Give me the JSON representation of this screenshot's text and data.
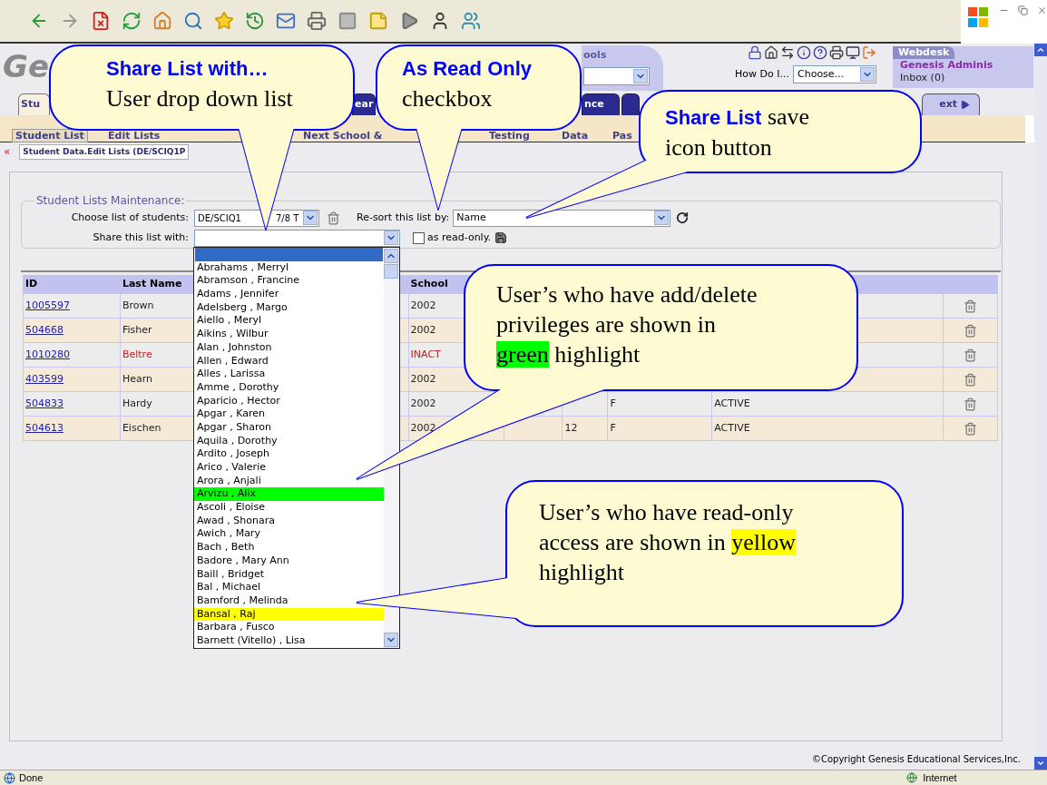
{
  "header": {
    "logo": "Ge",
    "schools_tab": "ools",
    "how_do_i": "How Do I...",
    "how_do_i_select": "Choose...",
    "webdesk": {
      "title": "Webdesk",
      "user": "Genesis Adminis",
      "inbox": "Inbox (0)"
    }
  },
  "tabs": [
    {
      "label": "Stu",
      "kind": "light"
    },
    {
      "label": "ear",
      "kind": "dark"
    },
    {
      "label": "nce",
      "kind": "dark"
    },
    {
      "kind": "dark"
    },
    {
      "label": "ext",
      "kind": "next"
    }
  ],
  "subtabs": [
    {
      "label": "Student List",
      "selected": true
    },
    {
      "label": "Edit Lists",
      "selected": false
    },
    {
      "label": "Next School &",
      "selected": false
    },
    {
      "label": "Testing",
      "selected": false
    },
    {
      "label": "Data",
      "selected": false
    },
    {
      "label": "Pas",
      "selected": false
    }
  ],
  "breadcrumb": {
    "back": "«",
    "path": "Student Data.Edit Lists (DE/SCIQ1P"
  },
  "maintenance": {
    "legend": "Student Lists Maintenance:",
    "choose_label": "Choose list of students:",
    "choose_value": [
      "DE/SCIQ1",
      "7/8 T"
    ],
    "resort_label": "Re-sort this list by:",
    "resort_value": "Name",
    "share_label": "Share this list with:",
    "read_only_label": "as read-only.",
    "read_only_checked": false
  },
  "share_options": [
    {
      "text": "Abrahams , Merryl"
    },
    {
      "text": "Abramson , Francine"
    },
    {
      "text": "Adams , Jennifer"
    },
    {
      "text": "Adelsberg , Margo"
    },
    {
      "text": "Aiello , Meryl"
    },
    {
      "text": "Aikins , Wilbur"
    },
    {
      "text": "Alan , Johnston"
    },
    {
      "text": "Allen , Edward"
    },
    {
      "text": "Alles , Larissa"
    },
    {
      "text": "Amme , Dorothy"
    },
    {
      "text": "Aparicio , Hector"
    },
    {
      "text": "Apgar , Karen"
    },
    {
      "text": "Apgar , Sharon"
    },
    {
      "text": "Aquila , Dorothy"
    },
    {
      "text": "Ardito , Joseph"
    },
    {
      "text": "Arico , Valerie"
    },
    {
      "text": "Arora , Anjali"
    },
    {
      "text": "Arvizu , Alix",
      "color": "#00ff00"
    },
    {
      "text": "Ascoli , Eloise"
    },
    {
      "text": "Awad , Shonara"
    },
    {
      "text": "Awich , Mary"
    },
    {
      "text": "Bach , Beth"
    },
    {
      "text": "Badore , Mary Ann"
    },
    {
      "text": "Baill , Bridget"
    },
    {
      "text": "Bal , Michael"
    },
    {
      "text": "Bamford , Melinda"
    },
    {
      "text": "Bansal , Raj",
      "color": "#ffff00"
    },
    {
      "text": "Barbara , Fusco"
    },
    {
      "text": "Barnett (Vitello) , Lisa"
    }
  ],
  "table": {
    "columns": [
      "ID",
      "Last Name",
      "School"
    ],
    "rows": [
      {
        "id": "1005597",
        "last_name": "Brown",
        "school": "2002",
        "inactive": false
      },
      {
        "id": "504668",
        "last_name": "Fisher",
        "school": "2002",
        "inactive": false
      },
      {
        "id": "1010280",
        "last_name": "Beltre",
        "school": "INACT",
        "inactive": true
      },
      {
        "id": "403599",
        "last_name": "Hearn",
        "school": "2002",
        "inactive": false
      },
      {
        "id": "504833",
        "last_name": "Hardy",
        "school": "2002",
        "inactive": false,
        "column_6": "F",
        "column_7": "ACTIVE"
      },
      {
        "id": "504613",
        "last_name": "Eischen",
        "school": "2002",
        "inactive": false,
        "column_5": "12",
        "column_6": "F",
        "column_7": "ACTIVE"
      }
    ]
  },
  "copyright": "©Copyright Genesis Educational Services,Inc.",
  "status_bar": {
    "left": "Done",
    "zone": "Internet"
  },
  "callouts": [
    {
      "lines": [
        [
          {
            "kind": "title",
            "text": "Share List with…"
          }
        ],
        [
          {
            "kind": "plain",
            "text": "User drop down list"
          }
        ]
      ]
    },
    {
      "lines": [
        [
          {
            "kind": "title",
            "text": "As Read Only"
          }
        ],
        [
          {
            "kind": "plain",
            "text": "checkbox"
          }
        ]
      ]
    },
    {
      "lines": [
        [
          {
            "kind": "title",
            "text": "Share List"
          },
          {
            "kind": "plain",
            "text": " save"
          }
        ],
        [
          {
            "kind": "plain",
            "text": "icon button"
          }
        ]
      ]
    },
    {
      "lines": [
        [
          {
            "kind": "plain",
            "text": "User’s who have add/delete"
          }
        ],
        [
          {
            "kind": "plain",
            "text": "privileges are shown in"
          }
        ],
        [
          {
            "kind": "highlight",
            "text": "green",
            "color": "#00ff00"
          },
          {
            "kind": "plain",
            "text": " highlight"
          }
        ]
      ]
    },
    {
      "lines": [
        [
          {
            "kind": "plain",
            "text": "User’s who have read-only"
          }
        ],
        [
          {
            "kind": "plain",
            "text": "access are shown in "
          },
          {
            "kind": "highlight",
            "text": "yellow",
            "color": "#ffff00"
          }
        ],
        [
          {
            "kind": "plain",
            "text": "highlight"
          }
        ]
      ]
    }
  ]
}
